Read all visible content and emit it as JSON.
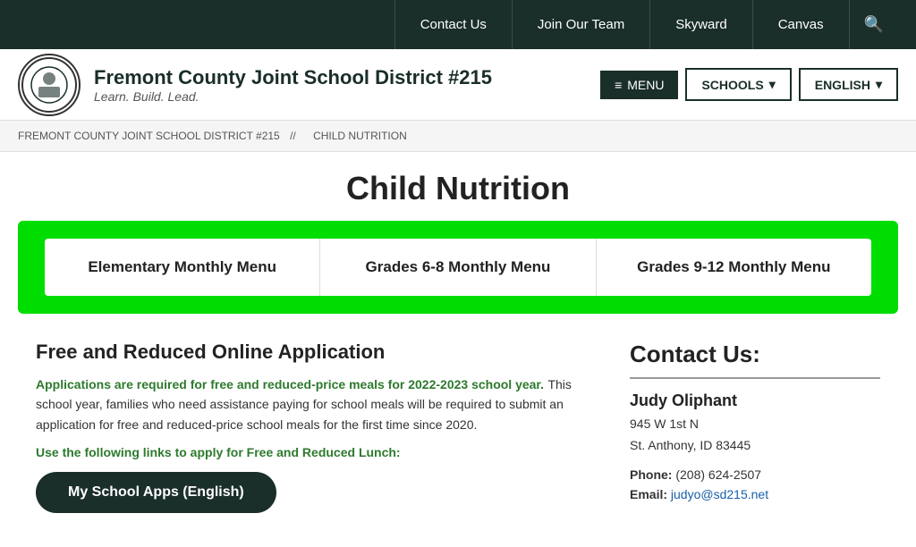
{
  "topbar": {
    "contact_us": "Contact Us",
    "join_our_team": "Join Our Team",
    "skyward": "Skyward",
    "canvas": "Canvas"
  },
  "header": {
    "school_name": "Fremont County Joint School District #215",
    "tagline": "Learn. Build. Lead.",
    "menu_label": "MENU",
    "schools_label": "SCHOOLS",
    "english_label": "ENGLISH"
  },
  "breadcrumb": {
    "home": "FREMONT COUNTY JOINT SCHOOL DISTRICT #215",
    "separator": "//",
    "current": "CHILD NUTRITION"
  },
  "page_title": "Child Nutrition",
  "tabs": [
    {
      "label": "Elementary Monthly Menu"
    },
    {
      "label": "Grades 6-8 Monthly Menu"
    },
    {
      "label": "Grades 9-12 Monthly Menu"
    }
  ],
  "free_reduced": {
    "title": "Free and Reduced Online Application",
    "highlight": "Applications are required for free and reduced-price meals for 2022-2023 school year.",
    "body": " This school year, families who need assistance paying for school meals will be required to submit an application for free and reduced-price school meals for the first time since 2020.",
    "link_text": "Use the following links to apply for Free and Reduced Lunch:",
    "button_label": "My School Apps (English)"
  },
  "contact": {
    "title": "Contact Us:",
    "name": "Judy Oliphant",
    "address_line1": "945 W 1st N",
    "address_line2": "St. Anthony, ID 83445",
    "phone_label": "Phone:",
    "phone_number": "(208) 624-2507",
    "email_label": "Email:",
    "email_address": "judyo@sd215.net"
  },
  "icons": {
    "search": "🔍",
    "hamburger": "≡",
    "chevron_down": "▾"
  }
}
